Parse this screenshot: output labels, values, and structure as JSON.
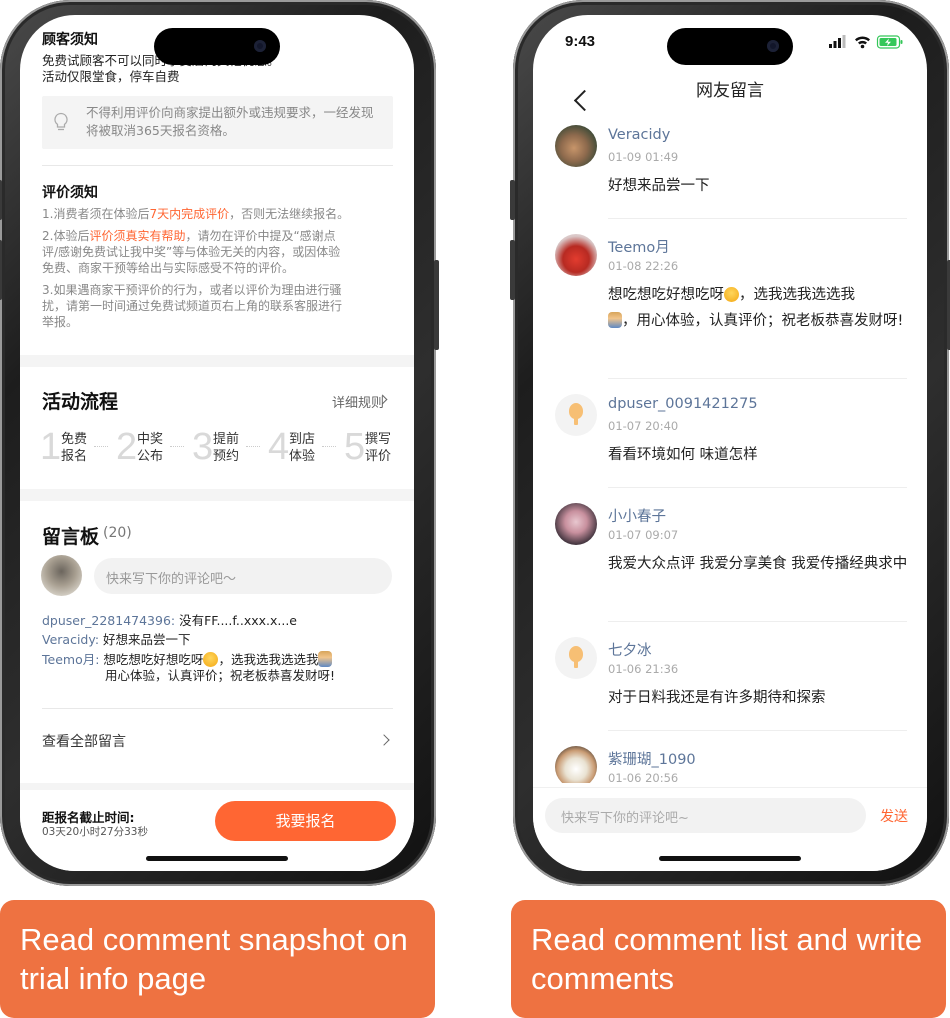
{
  "left_screen": {
    "customer_notice": {
      "title": "顾客须知",
      "line1": "免费试顾客不可以同时享受店内其他优惠。",
      "line2": "活动仅限堂食，停车自费",
      "tip_icon": "lightbulb-icon",
      "tip": "不得利用评价向商家提出额外或违规要求，一经发现将被取消365天报名资格。"
    },
    "review_notice": {
      "title": "评价须知",
      "item1_a": "1.消费者须在体验后",
      "item1_hl": "7天内完成评价",
      "item1_b": "，否则无法继续报名。",
      "item2_a": "2.体验后",
      "item2_hl": "评价须真实有帮助",
      "item2_b": "，请勿在评价中提及“感谢点",
      "item2_l2": "评/感谢免费试让我中奖”等与体验无关的内容，或因体验",
      "item2_l3": "免费、商家干预等给出与实际感受不符的评价。",
      "item3_l1": "3.如果遇商家干预评价的行为，或者以评价为理由进行骚",
      "item3_l2": "扰，请第一时间通过免费试频道页右上角的联系客服进行",
      "item3_l3": "举报。"
    },
    "flow": {
      "title": "活动流程",
      "rules_link": "详细规则",
      "steps": [
        {
          "num": "1",
          "line1": "免费",
          "line2": "报名"
        },
        {
          "num": "2",
          "line1": "中奖",
          "line2": "公布"
        },
        {
          "num": "3",
          "line1": "提前",
          "line2": "预约"
        },
        {
          "num": "4",
          "line1": "到店",
          "line2": "体验"
        },
        {
          "num": "5",
          "line1": "撰写",
          "line2": "评价"
        }
      ]
    },
    "board": {
      "title": "留言板",
      "count": "(20)",
      "input_placeholder": "快来写下你的评论吧～",
      "snapshots": [
        {
          "user": "dpuser_2281474396:",
          "text": "没有FF....f..xxx.x...e"
        },
        {
          "user": "Veracidy:",
          "text": "好想来品尝一下"
        },
        {
          "user": "Teemo月:",
          "text_a": "想吃想吃好想吃呀",
          "text_b": "，选我选我选选我",
          "text_c": "用心体验，认真评价；祝老板恭喜发财呀!"
        }
      ],
      "view_all": "查看全部留言"
    },
    "bottom": {
      "deadline_label": "距报名截止时间:",
      "deadline_value": "03天20小时27分33秒",
      "signup_button": "我要报名"
    }
  },
  "right_screen": {
    "status": {
      "time": "9:43"
    },
    "nav": {
      "title": "网友留言"
    },
    "comments": [
      {
        "user": "Veracidy",
        "date": "01-09 01:49",
        "text": "好想来品尝一下"
      },
      {
        "user": "Teemo月",
        "date": "01-08 22:26",
        "text_a": "想吃想吃好想吃呀",
        "text_b": "，选我选我选选我",
        "text_c": "，用心体验，认真评价；祝老板恭喜发财呀!"
      },
      {
        "user": "dpuser_0091421275",
        "date": "01-07 20:40",
        "text": "看看环境如何 味道怎样"
      },
      {
        "user": "小小春子",
        "date": "01-07 09:07",
        "text": "我爱大众点评 我爱分享美食 我爱传播经典求中"
      },
      {
        "user": "七夕冰",
        "date": "01-06 21:36",
        "text": "对于日料我还是有许多期待和探索"
      },
      {
        "user": "紫珊瑚_1090",
        "date": "01-06 20:56"
      }
    ],
    "bottom": {
      "input_placeholder": "快来写下你的评论吧~",
      "send": "发送"
    }
  },
  "captions": {
    "left": "Read comment snapshot on trial info page",
    "right": "Read comment list and write comments"
  },
  "colors": {
    "accent": "#ff6633",
    "caption_bg": "#ee7241",
    "username": "#5d7599"
  }
}
